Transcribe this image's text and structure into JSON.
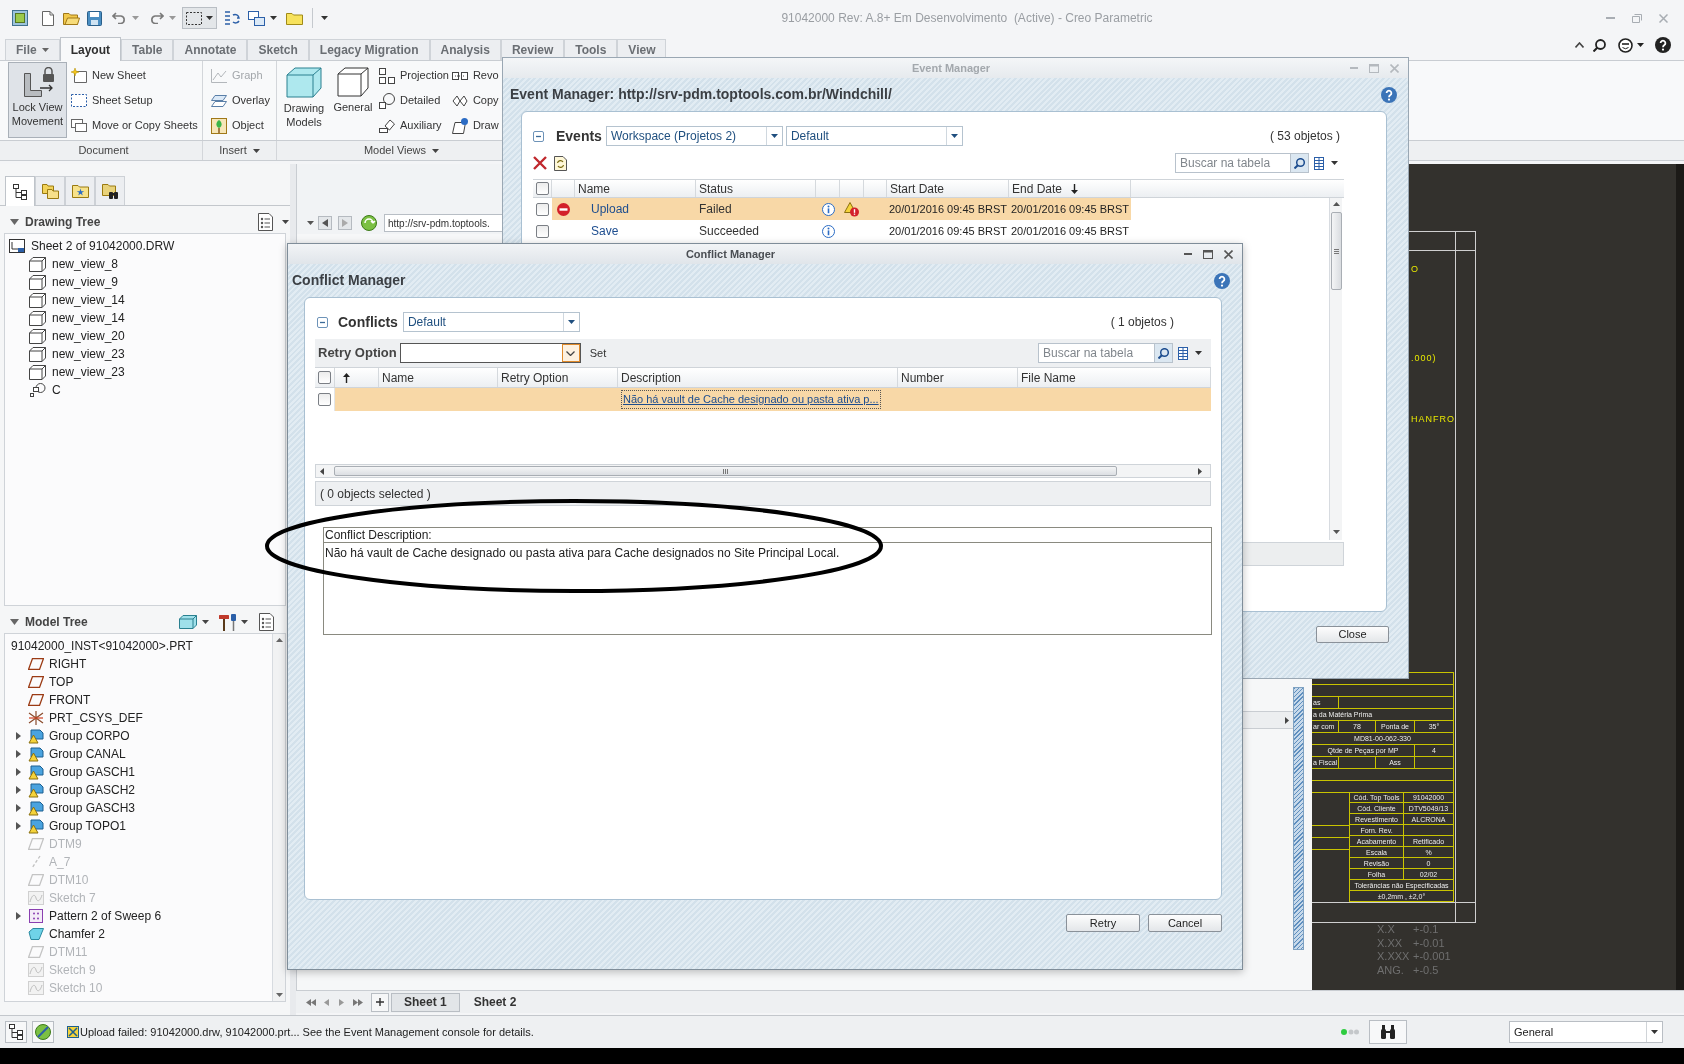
{
  "window": {
    "title": "91042000 Rev: A.8+ Em Desenvolvimento  (Active) - Creo Parametric"
  },
  "ribbon": {
    "tabs": [
      {
        "label": "File",
        "selected": false,
        "menu": true
      },
      {
        "label": "Layout",
        "selected": true,
        "menu": false
      },
      {
        "label": "Table",
        "selected": false,
        "menu": false
      },
      {
        "label": "Annotate",
        "selected": false,
        "menu": false
      },
      {
        "label": "Sketch",
        "selected": false,
        "menu": false
      },
      {
        "label": "Legacy Migration",
        "selected": false,
        "menu": false
      },
      {
        "label": "Analysis",
        "selected": false,
        "menu": false
      },
      {
        "label": "Review",
        "selected": false,
        "menu": false
      },
      {
        "label": "Tools",
        "selected": false,
        "menu": false
      },
      {
        "label": "View",
        "selected": false,
        "menu": false
      }
    ],
    "groups": [
      {
        "label": "Document",
        "menu": false,
        "large": [
          {
            "label": "Lock View Movement",
            "on": true
          }
        ],
        "small": [
          {
            "label": "New Sheet",
            "disabled": false
          },
          {
            "label": "Sheet Setup",
            "disabled": false
          },
          {
            "label": "Move or Copy Sheets",
            "disabled": false
          }
        ]
      },
      {
        "label": "Insert",
        "menu": true,
        "small": [
          {
            "label": "Graph",
            "disabled": true
          },
          {
            "label": "Overlay",
            "disabled": false
          },
          {
            "label": "Object",
            "disabled": false
          }
        ]
      },
      {
        "label": "Model Views",
        "menu": true,
        "large": [
          {
            "label": "Drawing Models",
            "on": false
          },
          {
            "label": "General",
            "on": false
          }
        ],
        "small": [
          {
            "label": "Projection",
            "disabled": false
          },
          {
            "label": "Detailed",
            "disabled": false
          },
          {
            "label": "Auxiliary",
            "disabled": false
          },
          {
            "label": "Revo",
            "disabled": false
          },
          {
            "label": "Copy",
            "disabled": false
          },
          {
            "label": "Draw",
            "disabled": false
          }
        ]
      }
    ]
  },
  "navigator": {
    "tabs": [
      {
        "selected": true
      },
      {
        "selected": false
      },
      {
        "selected": false
      },
      {
        "selected": false
      }
    ],
    "drawing_tree": {
      "title": "Drawing Tree",
      "expanded": true,
      "items": [
        {
          "label": "Sheet 2 of 91042000.DRW",
          "kind": "sheet",
          "children": [
            {
              "label": "new_view_8",
              "kind": "view"
            },
            {
              "label": "new_view_9",
              "kind": "view"
            },
            {
              "label": "new_view_14",
              "kind": "view"
            },
            {
              "label": "new_view_14",
              "kind": "view"
            },
            {
              "label": "new_view_20",
              "kind": "view"
            },
            {
              "label": "new_view_23",
              "kind": "view"
            },
            {
              "label": "new_view_23",
              "kind": "view"
            },
            {
              "label": "C",
              "kind": "detail"
            }
          ]
        }
      ]
    },
    "model_tree": {
      "title": "Model Tree",
      "expanded": true,
      "items": [
        {
          "label": "91042000_INST<91042000>.PRT",
          "children": [
            {
              "label": "RIGHT",
              "kind": "plane",
              "dimmed": false,
              "expandable": false
            },
            {
              "label": "TOP",
              "kind": "plane",
              "dimmed": false,
              "expandable": false
            },
            {
              "label": "FRONT",
              "kind": "plane",
              "dimmed": false,
              "expandable": false
            },
            {
              "label": "PRT_CSYS_DEF",
              "kind": "csys",
              "dimmed": false,
              "expandable": false
            },
            {
              "label": "Group CORPO",
              "kind": "group",
              "dimmed": false,
              "expandable": true
            },
            {
              "label": "Group CANAL",
              "kind": "group",
              "dimmed": false,
              "expandable": true
            },
            {
              "label": "Group GASCH1",
              "kind": "group",
              "dimmed": false,
              "expandable": true
            },
            {
              "label": "Group GASCH2",
              "kind": "group",
              "dimmed": false,
              "expandable": true
            },
            {
              "label": "Group GASCH3",
              "kind": "group",
              "dimmed": false,
              "expandable": true
            },
            {
              "label": "Group TOPO1",
              "kind": "group",
              "dimmed": false,
              "expandable": true
            },
            {
              "label": "DTM9",
              "kind": "plane",
              "dimmed": true,
              "expandable": false
            },
            {
              "label": "A_7",
              "kind": "axis",
              "dimmed": true,
              "expandable": false
            },
            {
              "label": "DTM10",
              "kind": "plane",
              "dimmed": true,
              "expandable": false
            },
            {
              "label": "Sketch 7",
              "kind": "sketch",
              "dimmed": true,
              "expandable": false
            },
            {
              "label": "Pattern 2 of Sweep 6",
              "kind": "pattern",
              "dimmed": false,
              "expandable": true
            },
            {
              "label": "Chamfer 2",
              "kind": "chamfer",
              "dimmed": false,
              "expandable": false
            },
            {
              "label": "DTM11",
              "kind": "plane",
              "dimmed": true,
              "expandable": false
            },
            {
              "label": "Sketch 9",
              "kind": "sketch",
              "dimmed": true,
              "expandable": false
            },
            {
              "label": "Sketch 10",
              "kind": "sketch",
              "dimmed": true,
              "expandable": false
            }
          ]
        }
      ]
    }
  },
  "browser": {
    "url": "http://srv-pdm.toptools."
  },
  "drawing": {
    "notes": [
      "O",
      ".000)",
      "HANFRO"
    ],
    "upper_block": [
      [
        "as"
      ],
      [
        "a da Matéria Prima"
      ],
      [
        "ar com",
        "78",
        "Ponta de",
        "35°"
      ],
      [
        "MD81-00-062-330"
      ],
      [
        "Qtde de Peças por MP",
        "4"
      ],
      [
        "a Fiscal",
        "Ass"
      ]
    ],
    "lower_block": [
      {
        "label": "Cód. Top Tools",
        "value": "91042000"
      },
      {
        "label": "Cód. Cliente",
        "value": "DTV5049/13"
      },
      {
        "label": "Revestimento",
        "value": "ALCRONA"
      },
      {
        "label": "Forn. Rev."
      },
      {
        "label": "Acabamento",
        "value": "Retificado"
      },
      {
        "label": "Escala",
        "value": "%"
      },
      {
        "label": "Revisão",
        "value": "0"
      },
      {
        "label": "Folha",
        "value": "02/02"
      }
    ],
    "tolerance_note": [
      "Tolerâncias não Especificadas",
      "±0,2mm , ±2,0°"
    ],
    "general_tolerances": [
      {
        "format": "X.X",
        "value": "+-0.1"
      },
      {
        "format": "X.XX",
        "value": "+-0.01"
      },
      {
        "format": "X.XXX",
        "value": "+-0.001"
      },
      {
        "format": "ANG.",
        "value": "+-0.5"
      }
    ]
  },
  "event_manager": {
    "title": "Event Manager",
    "heading": "Event Manager: http://srv-pdm.toptools.com.br/Windchill/",
    "section": {
      "label": "Events",
      "expanded": true
    },
    "filters": [
      "Workspace (Projetos 2)",
      "Default"
    ],
    "count": "( 53 objetos )",
    "search": {
      "placeholder": "Buscar na tabela"
    },
    "select_all": false,
    "sort_ascending": false,
    "columns": [
      {
        "label": "Name",
        "sorted": false
      },
      {
        "label": "Status",
        "sorted": false
      },
      {
        "label": "Start Date",
        "sorted": false
      },
      {
        "label": "End Date",
        "sorted": true
      }
    ],
    "rows": [
      {
        "name": "Upload",
        "status": "Failed",
        "start_date": "20/01/2016 09:45 BRST",
        "end_date": "20/01/2016 09:45 BRST",
        "selected": true,
        "checked": false,
        "error": true,
        "conflict": true
      },
      {
        "name": "Save",
        "status": "Succeeded",
        "start_date": "20/01/2016 09:45 BRST",
        "end_date": "20/01/2016 09:45 BRST",
        "selected": false,
        "checked": false,
        "error": false,
        "conflict": false
      }
    ],
    "close_button": "Close"
  },
  "conflict_manager": {
    "title": "Conflict Manager",
    "heading": "Conflict Manager",
    "section": {
      "label": "Conflicts",
      "expanded": true
    },
    "filter": "Default",
    "count": "( 1 objetos )",
    "retry_option": {
      "label": "Retry Option",
      "set_button": "Set"
    },
    "search": {
      "placeholder": "Buscar na tabela"
    },
    "select_all": false,
    "sort_ascending": true,
    "columns": [
      "Name",
      "Retry Option",
      "Description",
      "Number",
      "File Name"
    ],
    "rows": [
      {
        "description": "Não há vault de Cache designado ou pasta ativa p...",
        "selected": true,
        "checked": false
      }
    ],
    "selection_status": "( 0 objects selected )",
    "description_box": {
      "label": "Conflict Description:",
      "text": "Não há vault de Cache designado ou pasta ativa para Cache designados no Site Principal Local."
    },
    "buttons": [
      "Retry",
      "Cancel"
    ]
  },
  "sheet_tabs": [
    {
      "label": "Sheet 1",
      "selected": false
    },
    {
      "label": "Sheet 2",
      "selected": true
    }
  ],
  "status_bar": {
    "message": "Upload failed: 91042000.drw, 91042000.prt... See the Event Management console for details.",
    "display_filter": "General"
  }
}
